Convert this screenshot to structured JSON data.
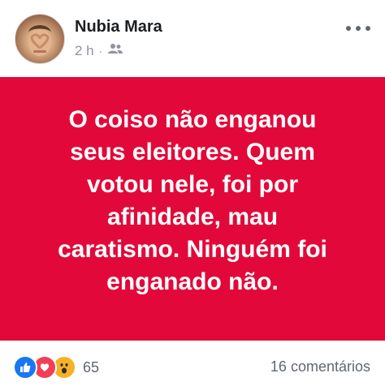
{
  "post": {
    "author": "Nubia Mara",
    "time": "2 h",
    "separator": "·",
    "audience_icon": "friends-icon",
    "text": "O coiso não enganou\nseus eleitores. Quem\nvotou nele, foi por\nafinidade, mau\ncaratismo. Ninguém  foi\nenganado não.",
    "background_color": "#e2093a",
    "text_color": "#ffffff"
  },
  "footer": {
    "reactions": [
      "like-icon",
      "love-icon",
      "wow-icon"
    ],
    "reaction_count": "65",
    "comments": "16 comentários"
  }
}
